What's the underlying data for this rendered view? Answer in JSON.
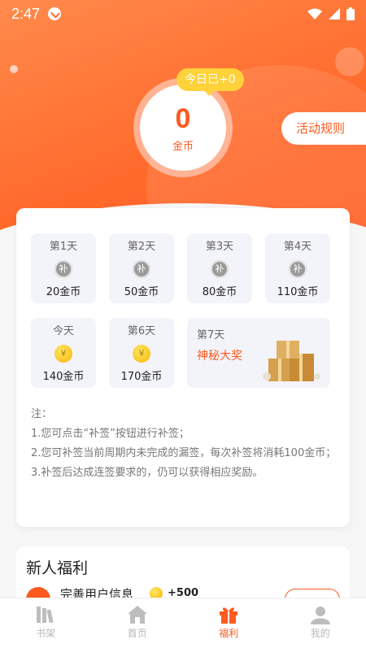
{
  "status": {
    "time": "2:47"
  },
  "header": {
    "coins_value": "0",
    "coins_unit": "金币",
    "today_tag": "今日已+0",
    "rules_button": "活动规则"
  },
  "checkin": {
    "days": [
      {
        "label": "第1天",
        "badge": "补",
        "amount": "20金币",
        "state": "missed"
      },
      {
        "label": "第2天",
        "badge": "补",
        "amount": "50金币",
        "state": "missed"
      },
      {
        "label": "第3天",
        "badge": "补",
        "amount": "80金币",
        "state": "missed"
      },
      {
        "label": "第4天",
        "badge": "补",
        "amount": "110金币",
        "state": "missed"
      },
      {
        "label": "今天",
        "badge": "¥",
        "amount": "140金币",
        "state": "today"
      },
      {
        "label": "第6天",
        "badge": "¥",
        "amount": "170金币",
        "state": "future"
      }
    ],
    "day7": {
      "label": "第7天",
      "prize": "神秘大奖"
    },
    "notes": [
      "注：",
      "1.您可点击“补签”按钮进行补签；",
      "2.您可补签当前周期内未完成的漏签，每次补签将消耗100金币；",
      "3.补签后达成连签要求的，仍可以获得相应奖励。"
    ]
  },
  "newbie": {
    "title": "新人福利",
    "row_text": "完善用户信息",
    "row_bonus": "+500"
  },
  "tabs": [
    {
      "label": "书架",
      "icon": "bookshelf-icon",
      "active": false
    },
    {
      "label": "首页",
      "icon": "home-icon",
      "active": false
    },
    {
      "label": "福利",
      "icon": "gift-icon",
      "active": true
    },
    {
      "label": "我的",
      "icon": "user-icon",
      "active": false
    }
  ],
  "colors": {
    "accent": "#ff5a1f",
    "tag": "#ffd23a",
    "tile": "#f3f4f9"
  }
}
